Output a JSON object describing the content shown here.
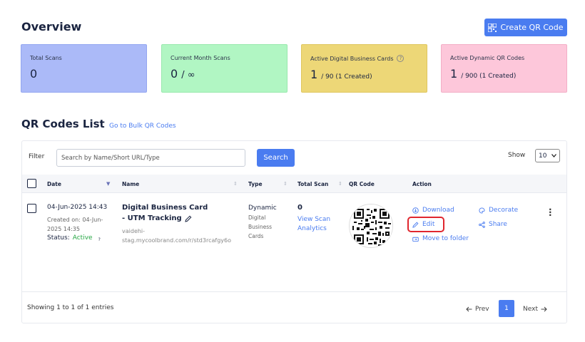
{
  "header": {
    "title": "Overview",
    "create_button": "Create QR Code"
  },
  "stats": [
    {
      "label": "Total Scans",
      "value": "0",
      "sub": ""
    },
    {
      "label": "Current Month Scans",
      "value": "0",
      "sub": "/ ∞"
    },
    {
      "label": "Active Digital Business Cards",
      "value": "1",
      "sub": "/ 90 (1 Created)"
    },
    {
      "label": "Active Dynamic QR Codes",
      "value": "1",
      "sub": "/ 900 (1 Created)"
    }
  ],
  "list": {
    "title": "QR Codes List",
    "bulk_link": "Go to Bulk QR Codes",
    "filter_label": "Filter",
    "search_placeholder": "Search by Name/Short URL/Type",
    "search_button": "Search",
    "show_label": "Show",
    "show_value": "10",
    "columns": [
      "Date",
      "Name",
      "Type",
      "Total Scan",
      "QR Code",
      "Action"
    ],
    "row": {
      "date": "04-Jun-2025 14:43",
      "created_on": "Created on: 04-Jun-",
      "created_time": "2025 14:35",
      "status_label": "Status:",
      "status_value": "Active",
      "name_line1": "Digital Business Card",
      "name_line2": "- UTM Tracking",
      "url_line1": "vaidehi-",
      "url_line2": "stag.mycoolbrand.com/r/std3rcafgy6o",
      "type_main": "Dynamic",
      "type_sub1": "Digital",
      "type_sub2": "Business",
      "type_sub3": "Cards",
      "total_scan": "0",
      "view_scan1": "View Scan",
      "view_scan2": "Analytics",
      "actions": {
        "download": "Download",
        "decorate": "Decorate",
        "edit": "Edit",
        "share": "Share",
        "move": "Move to folder"
      }
    },
    "footer": {
      "entries": "Showing 1 to 1 of 1 entries",
      "prev": "Prev",
      "page": "1",
      "next": "Next"
    }
  },
  "colors": {
    "accent": "#4a7cf0",
    "card1": "#abbaf8",
    "card2": "#b1f6c3",
    "card3": "#edd777",
    "card4": "#fdc7da",
    "active_status": "#27a745",
    "highlight": "#e0262e"
  }
}
